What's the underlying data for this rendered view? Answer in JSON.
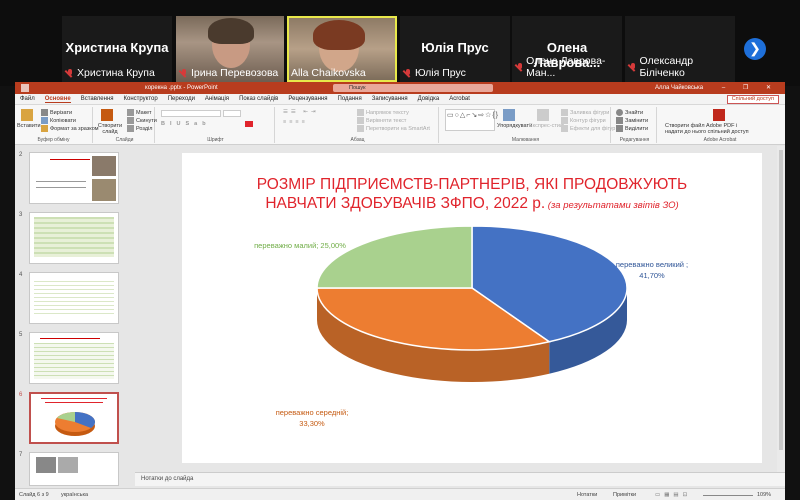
{
  "participants": [
    {
      "name": "Христина Крупа",
      "label": "Христина Крупа",
      "video": false
    },
    {
      "name": "",
      "label": "Ірина Перевозова",
      "video": true
    },
    {
      "name": "",
      "label": "Alla Chaikovska",
      "video": true
    },
    {
      "name": "Юлія Прус",
      "label": "Юлія Прус",
      "video": false
    },
    {
      "name": "Олена  Лаврова...",
      "label": "Олена Лаврова-Ман...",
      "video": false
    },
    {
      "name": "",
      "label": "Олександр Біліченко",
      "video": false
    }
  ],
  "next_arrow": "❯",
  "window": {
    "doc_title": "корекна .pptx - PowerPoint",
    "search_placeholder": "Пошук",
    "user": "Алла Чайковська",
    "share": "Спільний доступ",
    "win_buttons": "– ❐ ✕"
  },
  "menu_tabs": [
    "Файл",
    "Основне",
    "Вставлення",
    "Конструктор",
    "Переходи",
    "Анімація",
    "Показ слайдів",
    "Рецензування",
    "Подання",
    "Записування",
    "Довідка",
    "Acrobat"
  ],
  "ribbon": {
    "paste": "Вставити",
    "cut": "Вирізати",
    "copy": "Копіювати",
    "format_painter": "Формат за зразком",
    "clipboard_label": "Буфер обміну",
    "new_slide": "Створити слайд",
    "layout": "Макет",
    "reset": "Скинути",
    "section": "Розділ",
    "slides_label": "Слайди",
    "font_label": "Шрифт",
    "text_direction": "Напрямок тексту",
    "align_text": "Вирівняти текст",
    "smartart": "Перетворити на SmartArt",
    "paragraph_label": "Абзац",
    "arrange": "Упорядкувати",
    "quick_styles": "Експрес-стилі",
    "shape_fill": "Заливка фігури",
    "shape_outline": "Контур фігури",
    "shape_effects": "Ефекти для фігур",
    "drawing_label": "Малювання",
    "find": "Знайти",
    "replace": "Замінити",
    "select": "Виділити",
    "editing_label": "Редагування",
    "acrobat_create": "Створити файл Adobe PDF і",
    "acrobat_share": "надати до нього спільний доступ",
    "acrobat_label": "Adobe Acrobat"
  },
  "thumbnails": [
    "2",
    "3",
    "4",
    "5",
    "6",
    "7"
  ],
  "slide": {
    "title_line1": "РОЗМІР ПІДПРИЄМСТВ-ПАРТНЕРІВ, ЯКІ ПРОДОВЖУЮТЬ",
    "title_line2": "НАВЧАТИ ЗДОБУВАЧІВ ЗФПО, 2022 р.",
    "title_sub": " (за результатами звітів ЗО)"
  },
  "chart_data": {
    "type": "pie",
    "title": "",
    "categories": [
      "переважно великий",
      "переважно середній",
      "переважно малий"
    ],
    "values": [
      41.7,
      33.3,
      25.0
    ],
    "labels": [
      [
        "переважно великий ;",
        "41,70%"
      ],
      [
        "переважно середній;",
        "33,30%"
      ],
      [
        "переважно малий; 25,00%"
      ]
    ],
    "colors": [
      "#4472c4",
      "#ed7d31",
      "#a9d18e"
    ],
    "label_colors": [
      "#2f5597",
      "#c55a11",
      "#70ad47"
    ],
    "style": "3d"
  },
  "notes": "Нотатки до слайда",
  "status": {
    "slide_info": "Слайд 6 з 9",
    "language": "українська",
    "notes_btn": "Нотатки",
    "view_btn": "Примітки",
    "zoom": "109%"
  }
}
